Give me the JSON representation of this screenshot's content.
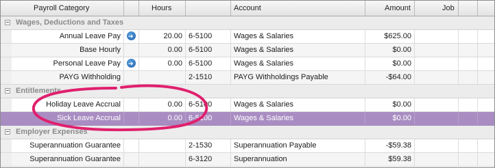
{
  "columns": {
    "payroll_category": "Payroll Category",
    "hours": "Hours",
    "account": "Account",
    "amount": "Amount",
    "job": "Job"
  },
  "groups": [
    {
      "title": "Wages, Deductions and Taxes",
      "rows": [
        {
          "category": "Annual Leave Pay",
          "arrow": true,
          "hours": "20.00",
          "account": "6-5100",
          "account_name": "Wages & Salaries",
          "amount": "$625.00"
        },
        {
          "category": "Base Hourly",
          "arrow": false,
          "hours": "0.00",
          "account": "6-5100",
          "account_name": "Wages & Salaries",
          "amount": "$0.00"
        },
        {
          "category": "Personal Leave Pay",
          "arrow": true,
          "hours": "0.00",
          "account": "6-5100",
          "account_name": "Wages & Salaries",
          "amount": "$0.00"
        },
        {
          "category": "PAYG Withholding",
          "arrow": false,
          "hours": "",
          "account": "2-1510",
          "account_name": "PAYG Withholdings Payable",
          "amount": "-$64.00"
        }
      ]
    },
    {
      "title": "Entitlements",
      "rows": [
        {
          "category": "Holiday Leave Accrual",
          "arrow": false,
          "hours": "0.00",
          "account": "6-5100",
          "account_name": "Wages & Salaries",
          "amount": "$0.00"
        },
        {
          "category": "Sick Leave Accrual",
          "arrow": false,
          "hours": "0.00",
          "account": "6-5100",
          "account_name": "Wages & Salaries",
          "amount": "$0.00",
          "selected": true
        }
      ]
    },
    {
      "title": "Employer Expenses",
      "rows": [
        {
          "category": "Superannuation Guarantee",
          "arrow": false,
          "hours": "",
          "account": "2-1530",
          "account_name": "Superannuation Payable",
          "amount": "-$59.38"
        },
        {
          "category": "Superannuation Guarantee",
          "arrow": false,
          "hours": "",
          "account": "6-3120",
          "account_name": "Superannuation",
          "amount": "$59.38"
        }
      ]
    }
  ],
  "colors": {
    "selected_row": "#a98dc2",
    "annotation_circle": "#e0206e",
    "arrow_icon": "#2a6fc0"
  },
  "icons": {
    "drilldown": "arrow-right-circle-icon",
    "collapse": "minus-box-icon"
  }
}
